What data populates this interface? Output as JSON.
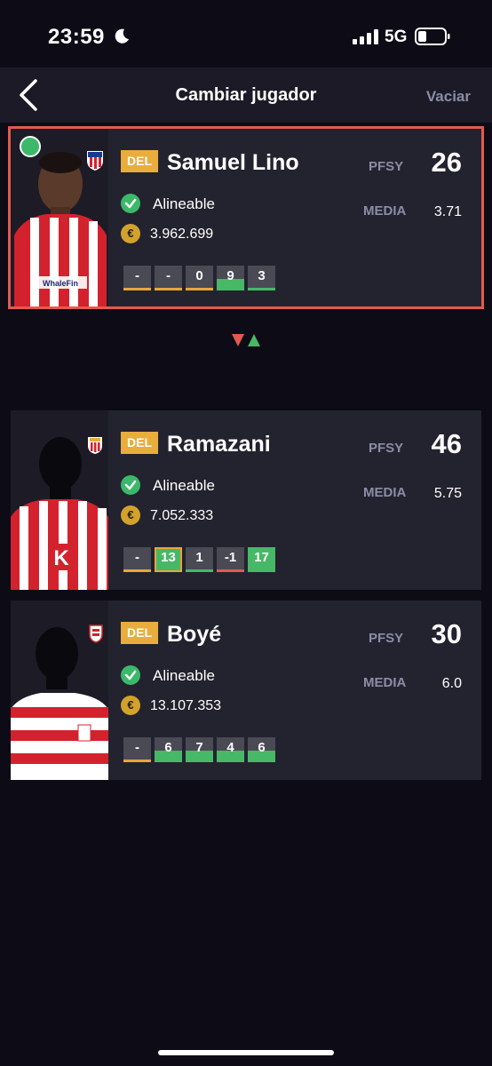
{
  "status_bar": {
    "time": "23:59",
    "network": "5G"
  },
  "nav": {
    "title": "Cambiar jugador",
    "clear_label": "Vaciar"
  },
  "players": [
    {
      "position": "DEL",
      "name": "Samuel Lino",
      "status": "Alineable",
      "price": "3.962.699",
      "pfsy_label": "PFSY",
      "pfsy": "26",
      "media_label": "MEDIA",
      "media": "3.71",
      "scores": [
        "-",
        "-",
        "0",
        "9",
        "3"
      ],
      "selected": true
    },
    {
      "position": "DEL",
      "name": "Ramazani",
      "status": "Alineable",
      "price": "7.052.333",
      "pfsy_label": "PFSY",
      "pfsy": "46",
      "media_label": "MEDIA",
      "media": "5.75",
      "scores": [
        "-",
        "13",
        "1",
        "-1",
        "17"
      ],
      "selected": false
    },
    {
      "position": "DEL",
      "name": "Boyé",
      "status": "Alineable",
      "price": "13.107.353",
      "pfsy_label": "PFSY",
      "pfsy": "30",
      "media_label": "MEDIA",
      "media": "6.0",
      "scores": [
        "-",
        "6",
        "7",
        "4",
        "6"
      ],
      "selected": false
    }
  ],
  "colors": {
    "background": "#0c0b16",
    "card": "#23232f",
    "accent_red": "#e25a4e",
    "accent_green": "#47b866",
    "badge": "#e8ad3d"
  },
  "icons": [
    "back-icon",
    "moon-icon",
    "signal-icon",
    "battery-icon",
    "check-icon",
    "coin-icon",
    "swap-icon"
  ]
}
